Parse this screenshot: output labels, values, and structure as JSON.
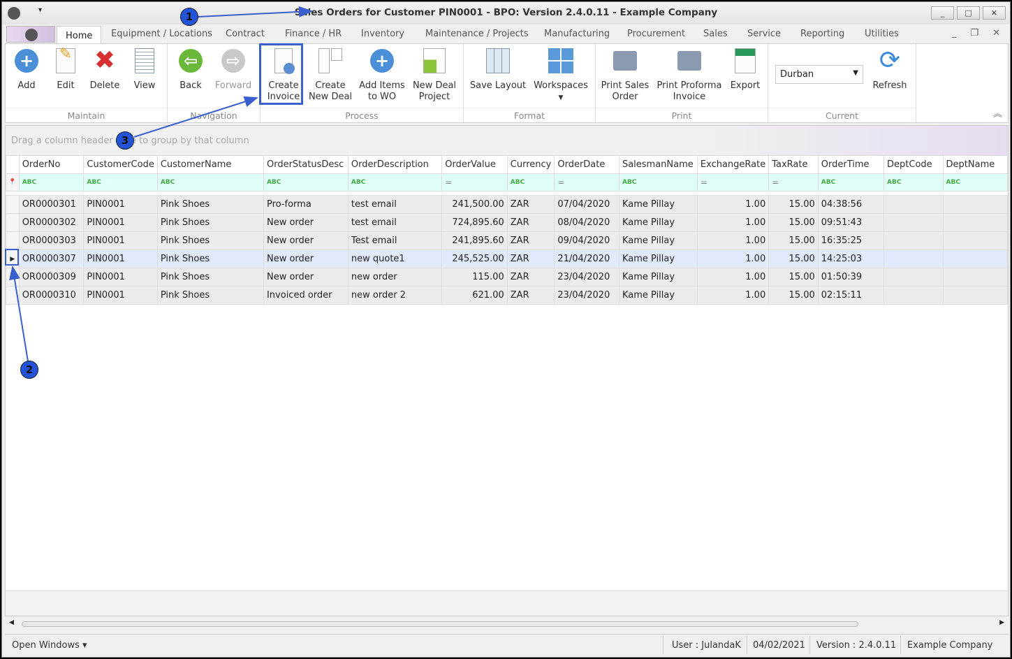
{
  "window": {
    "title": "Sales Orders for Customer PIN0001 - BPO: Version 2.4.0.11 - Example Company"
  },
  "tabs": [
    {
      "label": "Home",
      "active": true
    },
    {
      "label": "Equipment / Locations"
    },
    {
      "label": "Contract"
    },
    {
      "label": "Finance / HR"
    },
    {
      "label": "Inventory"
    },
    {
      "label": "Maintenance / Projects"
    },
    {
      "label": "Manufacturing"
    },
    {
      "label": "Procurement"
    },
    {
      "label": "Sales"
    },
    {
      "label": "Service"
    },
    {
      "label": "Reporting"
    },
    {
      "label": "Utilities"
    }
  ],
  "ribbon": {
    "groups": [
      "Maintain",
      "Navigation",
      "Process",
      "Format",
      "Print",
      "Current"
    ],
    "buttons": {
      "add": "Add",
      "edit": "Edit",
      "delete": "Delete",
      "view": "View",
      "back": "Back",
      "forward": "Forward",
      "create_invoice_1": "Create",
      "create_invoice_2": "Invoice",
      "create_deal_1": "Create",
      "create_deal_2": "New Deal",
      "add_items_1": "Add Items",
      "add_items_2": "to WO",
      "new_deal_1": "New Deal",
      "new_deal_2": "Project",
      "save_layout": "Save Layout",
      "workspaces": "Workspaces",
      "print_sales_1": "Print Sales",
      "print_sales_2": "Order",
      "print_proforma_1": "Print Proforma",
      "print_proforma_2": "Invoice",
      "export": "Export",
      "refresh": "Refresh"
    },
    "branch_select": "Durban"
  },
  "grid": {
    "group_panel": "Drag a column header here to group by that column",
    "columns": [
      "OrderNo",
      "CustomerCode",
      "CustomerName",
      "OrderStatusDesc",
      "OrderDescription",
      "OrderValue",
      "Currency",
      "OrderDate",
      "SalesmanName",
      "ExchangeRate",
      "TaxRate",
      "OrderTime",
      "DeptCode",
      "DeptName"
    ],
    "rows": [
      [
        "OR0000301",
        "PIN0001",
        "Pink Shoes",
        "Pro-forma",
        "test email",
        "241,500.00",
        "ZAR",
        "07/04/2020",
        "Kame Pillay",
        "1.00",
        "15.00",
        "04:38:56",
        "",
        ""
      ],
      [
        "OR0000302",
        "PIN0001",
        "Pink Shoes",
        "New order",
        "test email",
        "724,895.60",
        "ZAR",
        "08/04/2020",
        "Kame Pillay",
        "1.00",
        "15.00",
        "09:51:43",
        "",
        ""
      ],
      [
        "OR0000303",
        "PIN0001",
        "Pink Shoes",
        "New order",
        "Test email",
        "241,895.60",
        "ZAR",
        "09/04/2020",
        "Kame Pillay",
        "1.00",
        "15.00",
        "16:35:25",
        "",
        ""
      ],
      [
        "OR0000307",
        "PIN0001",
        "Pink Shoes",
        "New order",
        "new quote1",
        "245,525.00",
        "ZAR",
        "21/04/2020",
        "Kame Pillay",
        "1.00",
        "15.00",
        "14:25:03",
        "",
        ""
      ],
      [
        "OR0000309",
        "PIN0001",
        "Pink Shoes",
        "New order",
        "new order",
        "115.00",
        "ZAR",
        "23/04/2020",
        "Kame Pillay",
        "1.00",
        "15.00",
        "01:50:39",
        "",
        ""
      ],
      [
        "OR0000310",
        "PIN0001",
        "Pink Shoes",
        "Invoiced order",
        "new order 2",
        "621.00",
        "ZAR",
        "23/04/2020",
        "Kame Pillay",
        "1.00",
        "15.00",
        "02:15:11",
        "",
        ""
      ]
    ],
    "selected_row": 3
  },
  "status": {
    "open_windows": "Open Windows ▾",
    "user": "User : JulandaK",
    "date": "04/02/2021",
    "version": "Version : 2.4.0.11",
    "company": "Example Company"
  },
  "annotations": [
    "1",
    "2",
    "3"
  ],
  "colors": {
    "accent": "#3a5fcf",
    "selected_row": "#e1e9fa",
    "filter_row": "#e0fff8"
  }
}
